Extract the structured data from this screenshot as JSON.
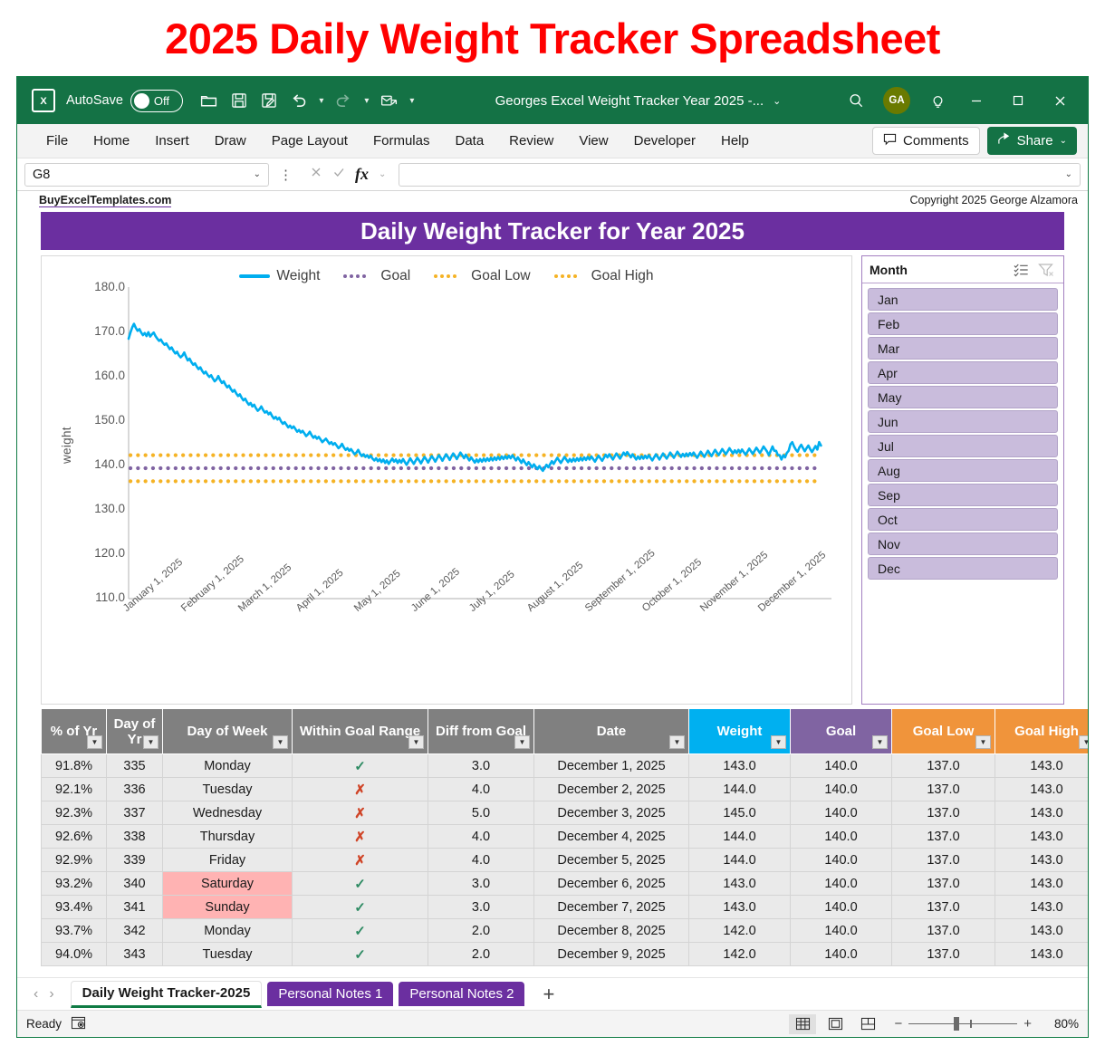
{
  "banner": {
    "title": "2025 Daily Weight Tracker Spreadsheet",
    "color": "#ff0000"
  },
  "titlebar": {
    "app_icon": "excel-icon",
    "autosave_label": "AutoSave",
    "autosave_state": "Off",
    "document_title": "Georges Excel Weight Tracker Year 2025 -...",
    "avatar_initials": "GA",
    "quick_access": [
      "open-icon",
      "save-icon",
      "save-as-icon",
      "undo-icon",
      "redo-icon",
      "email-icon",
      "customize-qat-icon"
    ],
    "window_controls": [
      "search-icon",
      "tell-me-icon",
      "minimize",
      "maximize",
      "close"
    ]
  },
  "ribbon": {
    "tabs": [
      "File",
      "Home",
      "Insert",
      "Draw",
      "Page Layout",
      "Formulas",
      "Data",
      "Review",
      "View",
      "Developer",
      "Help"
    ],
    "comments_label": "Comments",
    "share_label": "Share"
  },
  "formula_bar": {
    "name_box": "G8",
    "formula_value": "",
    "cancel_icon": "cancel-icon",
    "enter_icon": "enter-icon",
    "fx_icon": "insert-function-icon"
  },
  "sheet": {
    "website": "BuyExcelTemplates.com",
    "copyright": "Copyright 2025  George Alzamora",
    "title": "Daily Weight Tracker for Year 2025",
    "title_bg": "#6b2fa0"
  },
  "chart_data": {
    "type": "line",
    "title": "",
    "xlabel": "",
    "ylabel": "weight",
    "ylim": [
      110.0,
      180.0
    ],
    "ytick_labels": [
      "180.0",
      "170.0",
      "160.0",
      "150.0",
      "140.0",
      "130.0",
      "120.0",
      "110.0"
    ],
    "yticks": [
      180.0,
      170.0,
      160.0,
      150.0,
      140.0,
      130.0,
      120.0,
      110.0
    ],
    "xtick_labels": [
      "January 1, 2025",
      "February 1, 2025",
      "March 1, 2025",
      "April 1, 2025",
      "May 1, 2025",
      "June 1, 2025",
      "July 1, 2025",
      "August 1, 2025",
      "September 1, 2025",
      "October 1, 2025",
      "November 1, 2025",
      "December 1, 2025"
    ],
    "grid": false,
    "legend_position": "top",
    "legend": [
      {
        "name": "Weight",
        "color": "#00aeef",
        "style": "solid"
      },
      {
        "name": "Goal",
        "color": "#8064a2",
        "style": "dotted"
      },
      {
        "name": "Goal Low",
        "color": "#f5b325",
        "style": "dotted"
      },
      {
        "name": "Goal High",
        "color": "#f5b325",
        "style": "dotted"
      }
    ],
    "series": [
      {
        "name": "Weight",
        "color": "#00aeef",
        "style": "solid",
        "values": [
          169.8,
          171.2,
          172.4,
          173.2,
          172.3,
          171.6,
          172.0,
          171.2,
          170.6,
          171.1,
          170.4,
          171.3,
          170.3,
          170.8,
          171.2,
          170.4,
          169.8,
          169.3,
          169.6,
          168.9,
          168.4,
          168.7,
          168.0,
          167.4,
          167.8,
          167.0,
          166.4,
          166.8,
          166.0,
          165.5,
          165.9,
          166.6,
          165.6,
          164.8,
          165.2,
          164.4,
          163.8,
          164.1,
          163.4,
          162.8,
          163.2,
          162.4,
          161.8,
          162.2,
          161.5,
          161.0,
          161.4,
          160.6,
          160.0,
          160.4,
          161.2,
          160.3,
          159.6,
          160.0,
          159.2,
          158.6,
          159.0,
          158.2,
          157.6,
          158.0,
          157.2,
          156.6,
          157.0,
          156.2,
          155.6,
          156.0,
          155.2,
          154.6,
          155.0,
          154.2,
          154.6,
          153.8,
          153.2,
          153.6,
          154.2,
          153.4,
          152.8,
          153.1,
          152.4,
          152.8,
          152.0,
          151.4,
          151.8,
          151.2,
          151.6,
          150.8,
          150.2,
          150.6,
          150.0,
          149.4,
          149.8,
          149.2,
          149.6,
          149.0,
          148.4,
          148.8,
          148.2,
          148.6,
          148.0,
          147.4,
          147.8,
          148.4,
          147.6,
          147.0,
          147.4,
          146.8,
          147.2,
          146.6,
          146.0,
          146.4,
          146.8,
          146.2,
          145.6,
          146.0,
          145.4,
          145.8,
          145.2,
          144.6,
          145.0,
          145.6,
          144.8,
          144.2,
          144.6,
          144.0,
          144.4,
          143.8,
          143.2,
          143.6,
          144.2,
          143.4,
          142.8,
          143.2,
          142.6,
          143.0,
          142.4,
          142.9,
          142.2,
          141.8,
          142.3,
          141.6,
          142.1,
          141.4,
          142.0,
          141.2,
          141.8,
          141.0,
          141.6,
          142.2,
          141.5,
          142.0,
          141.2,
          141.9,
          141.3,
          142.1,
          141.4,
          140.8,
          141.5,
          142.3,
          141.6,
          141.0,
          141.7,
          142.4,
          141.8,
          141.1,
          141.9,
          142.6,
          142.0,
          141.3,
          142.1,
          142.8,
          142.2,
          141.5,
          142.3,
          143.0,
          142.4,
          141.7,
          142.5,
          143.2,
          142.6,
          141.9,
          142.7,
          143.4,
          142.8,
          142.1,
          142.9,
          143.6,
          143.0,
          142.3,
          143.1,
          142.4,
          141.8,
          142.5,
          141.9,
          141.3,
          142.0,
          141.4,
          142.1,
          141.5,
          142.2,
          141.6,
          142.3,
          141.7,
          142.4,
          141.8,
          142.5,
          141.9,
          142.6,
          142.0,
          142.7,
          142.1,
          142.8,
          142.2,
          142.9,
          142.3,
          143.0,
          142.4,
          141.8,
          142.5,
          141.9,
          141.2,
          142.0,
          141.3,
          140.7,
          141.4,
          140.8,
          140.2,
          140.9,
          140.3,
          139.8,
          140.5,
          139.9,
          139.4,
          140.1,
          140.8,
          140.2,
          140.9,
          141.6,
          141.0,
          141.7,
          142.4,
          141.8,
          141.2,
          141.9,
          142.6,
          142.0,
          141.4,
          142.1,
          141.5,
          142.2,
          141.6,
          142.3,
          141.7,
          142.4,
          141.8,
          142.5,
          141.9,
          142.6,
          142.0,
          142.7,
          142.1,
          141.5,
          142.2,
          142.9,
          142.3,
          141.7,
          142.4,
          143.1,
          142.5,
          143.2,
          142.6,
          142.0,
          142.7,
          143.4,
          142.8,
          142.2,
          142.9,
          143.6,
          143.0,
          143.7,
          143.1,
          142.5,
          143.2,
          142.6,
          142.0,
          142.7,
          142.1,
          142.8,
          142.2,
          142.9,
          142.3,
          143.0,
          142.4,
          141.8,
          142.5,
          143.2,
          142.6,
          142.0,
          142.7,
          143.4,
          142.8,
          142.2,
          142.9,
          143.6,
          143.0,
          142.4,
          143.1,
          143.8,
          143.2,
          142.6,
          143.3,
          142.7,
          143.4,
          142.8,
          143.5,
          142.9,
          143.6,
          143.0,
          142.4,
          143.1,
          143.8,
          143.2,
          142.6,
          143.3,
          144.0,
          143.4,
          142.8,
          143.5,
          144.2,
          143.6,
          143.0,
          143.7,
          144.4,
          143.8,
          143.2,
          143.9,
          144.6,
          144.0,
          143.4,
          144.1,
          143.5,
          144.2,
          143.6,
          144.3,
          143.7,
          143.1,
          143.8,
          144.5,
          143.9,
          143.3,
          144.0,
          144.7,
          144.1,
          143.5,
          144.2,
          145.0,
          144.4,
          143.8,
          143.0,
          144.0,
          145.0,
          144.0,
          144.0,
          143.0,
          143.0,
          142.0,
          143.0,
          142.5,
          143.5,
          144.0,
          145.5,
          146.0,
          145.0,
          144.3,
          143.8,
          144.8,
          145.4,
          144.6,
          143.9,
          144.6,
          145.2,
          144.4,
          143.7,
          144.4,
          145.1,
          144.3,
          146.0,
          145.2
        ]
      },
      {
        "name": "Goal",
        "color": "#8064a2",
        "style": "dotted",
        "constant": 140.0
      },
      {
        "name": "Goal Low",
        "color": "#f5b325",
        "style": "dotted",
        "constant": 137.0
      },
      {
        "name": "Goal High",
        "color": "#f5b325",
        "style": "dotted",
        "constant": 143.0
      }
    ]
  },
  "slicer": {
    "title": "Month",
    "multiselect_icon": "multi-select-icon",
    "clear_filter_icon": "clear-filter-icon",
    "items": [
      "Jan",
      "Feb",
      "Mar",
      "Apr",
      "May",
      "Jun",
      "Jul",
      "Aug",
      "Sep",
      "Oct",
      "Nov",
      "Dec"
    ]
  },
  "table": {
    "headers": [
      {
        "label": "% of Yr",
        "key": "pct",
        "class": "c-grey"
      },
      {
        "label": "Day of Yr",
        "key": "doy",
        "class": "c-grey"
      },
      {
        "label": "Day of Week",
        "key": "dow",
        "class": "c-grey"
      },
      {
        "label": "Within Goal Range",
        "key": "within",
        "class": "c-grey"
      },
      {
        "label": "Diff from Goal",
        "key": "diff",
        "class": "c-grey"
      },
      {
        "label": "Date",
        "key": "date",
        "class": "c-grey"
      },
      {
        "label": "Weight",
        "key": "weight",
        "class": "c-weight"
      },
      {
        "label": "Goal",
        "key": "goal",
        "class": "c-goal"
      },
      {
        "label": "Goal Low",
        "key": "low",
        "class": "c-low"
      },
      {
        "label": "Goal High",
        "key": "high",
        "class": "c-high"
      }
    ],
    "rows": [
      {
        "pct": "91.8%",
        "doy": "335",
        "dow": "Monday",
        "weekend": false,
        "within": "check",
        "diff": "3.0",
        "date": "December 1, 2025",
        "weight": "143.0",
        "goal": "140.0",
        "low": "137.0",
        "high": "143.0"
      },
      {
        "pct": "92.1%",
        "doy": "336",
        "dow": "Tuesday",
        "weekend": false,
        "within": "cross",
        "diff": "4.0",
        "date": "December 2, 2025",
        "weight": "144.0",
        "goal": "140.0",
        "low": "137.0",
        "high": "143.0"
      },
      {
        "pct": "92.3%",
        "doy": "337",
        "dow": "Wednesday",
        "weekend": false,
        "within": "cross",
        "diff": "5.0",
        "date": "December 3, 2025",
        "weight": "145.0",
        "goal": "140.0",
        "low": "137.0",
        "high": "143.0"
      },
      {
        "pct": "92.6%",
        "doy": "338",
        "dow": "Thursday",
        "weekend": false,
        "within": "cross",
        "diff": "4.0",
        "date": "December 4, 2025",
        "weight": "144.0",
        "goal": "140.0",
        "low": "137.0",
        "high": "143.0"
      },
      {
        "pct": "92.9%",
        "doy": "339",
        "dow": "Friday",
        "weekend": false,
        "within": "cross",
        "diff": "4.0",
        "date": "December 5, 2025",
        "weight": "144.0",
        "goal": "140.0",
        "low": "137.0",
        "high": "143.0"
      },
      {
        "pct": "93.2%",
        "doy": "340",
        "dow": "Saturday",
        "weekend": true,
        "within": "check",
        "diff": "3.0",
        "date": "December 6, 2025",
        "weight": "143.0",
        "goal": "140.0",
        "low": "137.0",
        "high": "143.0"
      },
      {
        "pct": "93.4%",
        "doy": "341",
        "dow": "Sunday",
        "weekend": true,
        "within": "check",
        "diff": "3.0",
        "date": "December 7, 2025",
        "weight": "143.0",
        "goal": "140.0",
        "low": "137.0",
        "high": "143.0"
      },
      {
        "pct": "93.7%",
        "doy": "342",
        "dow": "Monday",
        "weekend": false,
        "within": "check",
        "diff": "2.0",
        "date": "December 8, 2025",
        "weight": "142.0",
        "goal": "140.0",
        "low": "137.0",
        "high": "143.0"
      },
      {
        "pct": "94.0%",
        "doy": "343",
        "dow": "Tuesday",
        "weekend": false,
        "within": "check",
        "diff": "2.0",
        "date": "December 9, 2025",
        "weight": "142.0",
        "goal": "140.0",
        "low": "137.0",
        "high": "143.0"
      }
    ]
  },
  "tabbar": {
    "prev_icon": "chevron-left-icon",
    "next_icon": "chevron-right-icon",
    "tabs": [
      {
        "label": "Daily Weight Tracker-2025",
        "active": true
      },
      {
        "label": "Personal Notes 1",
        "active": false
      },
      {
        "label": "Personal Notes 2",
        "active": false
      }
    ],
    "add_label": "+"
  },
  "statusbar": {
    "status": "Ready",
    "macro_icon": "record-macro-icon",
    "views": [
      "normal-view-icon",
      "page-layout-view-icon",
      "page-break-view-icon"
    ],
    "zoom_out": "−",
    "zoom_in": "+",
    "zoom_level": "80%"
  }
}
